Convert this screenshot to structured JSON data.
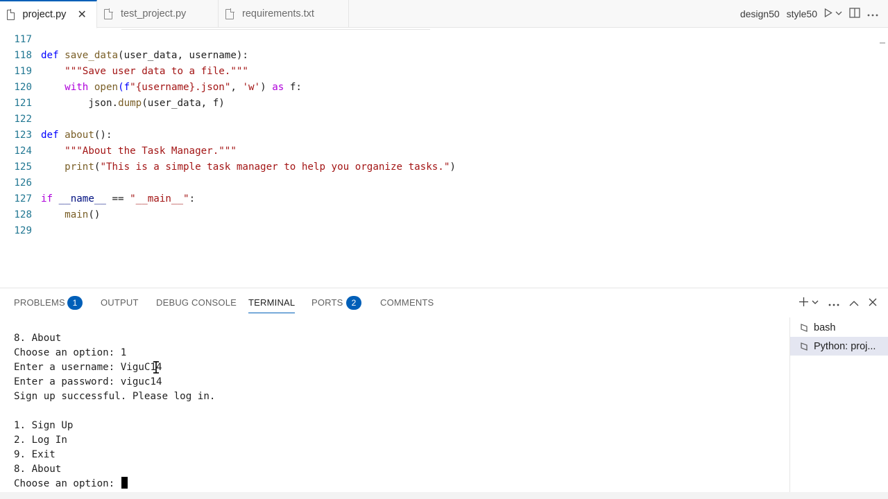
{
  "tabs": [
    {
      "label": "project.py",
      "active": true,
      "close": "✕"
    },
    {
      "label": "test_project.py",
      "active": false
    },
    {
      "label": "requirements.txt",
      "active": false
    }
  ],
  "tabbar_right": {
    "item1": "design50",
    "item2": "style50",
    "icons": [
      "run-icon",
      "chevron-down-icon",
      "split-editor-icon",
      "more-icon"
    ]
  },
  "editor": {
    "lines": [
      {
        "n": "117"
      },
      {
        "n": "118"
      },
      {
        "n": "119"
      },
      {
        "n": "120"
      },
      {
        "n": "121"
      },
      {
        "n": "122"
      },
      {
        "n": "123"
      },
      {
        "n": "124"
      },
      {
        "n": "125"
      },
      {
        "n": "126"
      },
      {
        "n": "127"
      },
      {
        "n": "128"
      },
      {
        "n": "129"
      }
    ],
    "code": {
      "l118_def": "def",
      "l118_name": "save_data",
      "l118_args": "(user_data, username):",
      "l119": "\"\"\"Save user data to a file.\"\"\"",
      "l120_with": "with",
      "l120_open": "open",
      "l120_f": "(f",
      "l120_str1": "\"{username}.json\"",
      "l120_mid": ", ",
      "l120_str2": "'w'",
      "l120_close": ") ",
      "l120_as": "as",
      "l120_end": " f:",
      "l121_mod": "json.",
      "l121_dump": "dump",
      "l121_args": "(user_data, f)",
      "l123_def": "def",
      "l123_name": "about",
      "l123_args": "():",
      "l124": "\"\"\"About the Task Manager.\"\"\"",
      "l125_print": "print",
      "l125_open": "(",
      "l125_str": "\"This is a simple task manager to help you organize tasks.\"",
      "l125_close": ")",
      "l127_if": "if",
      "l127_name": " __name__ ",
      "l127_eq": "== ",
      "l127_str": "\"__main__\"",
      "l127_colon": ":",
      "l128_main": "main",
      "l128_args": "()"
    }
  },
  "panel": {
    "tabs": {
      "problems": "PROBLEMS",
      "problems_badge": "1",
      "output": "OUTPUT",
      "debug": "DEBUG CONSOLE",
      "terminal": "TERMINAL",
      "ports": "PORTS",
      "ports_badge": "2",
      "comments": "COMMENTS"
    },
    "actions": [
      "plus-icon",
      "chevron-down-icon",
      "more-icon",
      "maximize-icon",
      "close-icon"
    ]
  },
  "terminal": {
    "lines": [
      "8. About",
      "Choose an option: 1",
      "Enter a username: ViguC14",
      "Enter a password: viguc14",
      "Sign up successful. Please log in.",
      "",
      "1. Sign Up",
      "2. Log In",
      "9. Exit",
      "8. About"
    ],
    "prompt": "Choose an option: "
  },
  "terminal_list": [
    {
      "label": "bash",
      "selected": false
    },
    {
      "label": "Python: proj...",
      "selected": true
    }
  ]
}
